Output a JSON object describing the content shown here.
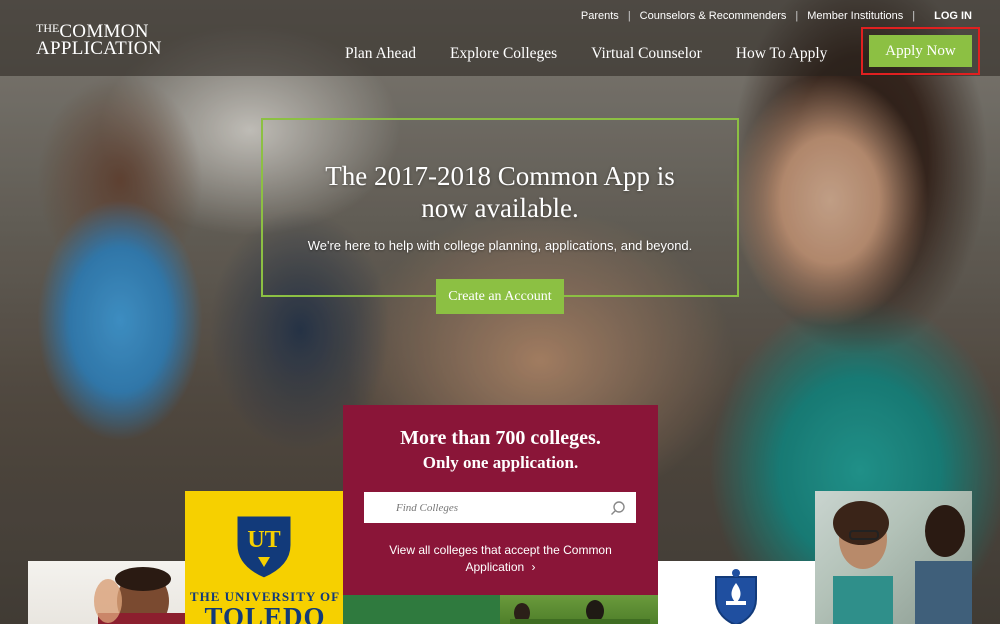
{
  "brand": {
    "logo_line1_small": "THE",
    "logo_line1": "COMMON",
    "logo_line2": "APPLICATION"
  },
  "utility_nav": {
    "links": [
      "Parents",
      "Counselors & Recommenders",
      "Member Institutions"
    ],
    "login": "LOG IN"
  },
  "main_nav": {
    "items": [
      "Plan Ahead",
      "Explore Colleges",
      "Virtual Counselor",
      "How To Apply"
    ],
    "apply_now": "Apply Now"
  },
  "hero": {
    "title_line1": "The 2017-2018 Common App is",
    "title_line2": "now available.",
    "subtitle": "We're here to help with college planning, applications, and beyond.",
    "cta": "Create an Account"
  },
  "college_search": {
    "heading": "More than 700 colleges.",
    "subheading": "Only one application.",
    "placeholder": "Find Colleges",
    "view_all": "View all colleges that accept the Common Application",
    "view_all_arrow": "›"
  },
  "tiles": {
    "toledo_monogram": "UT",
    "toledo_line1": "THE UNIVERSITY OF",
    "toledo_line2": "TOLEDO"
  },
  "colors": {
    "accent_green": "#8cc043",
    "burgundy": "#8a1538",
    "highlight_red": "#e02020",
    "toledo_yellow": "#f6d000",
    "toledo_blue": "#123a7a"
  }
}
